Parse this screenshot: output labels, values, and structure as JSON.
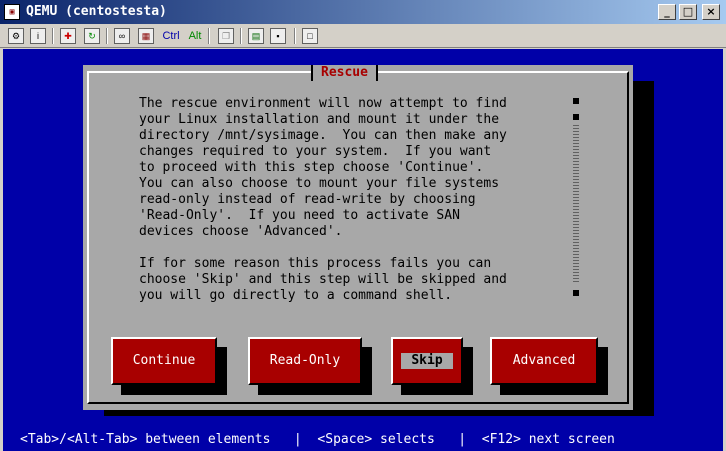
{
  "window": {
    "title": "QEMU (centostesta)",
    "controls": [
      "_",
      "□",
      "×"
    ]
  },
  "toolbar": {
    "ctrl_label": "Ctrl",
    "alt_label": "Alt"
  },
  "dialog": {
    "title": "Rescue",
    "body": "The rescue environment will now attempt to find\nyour Linux installation and mount it under the\ndirectory /mnt/sysimage.  You can then make any\nchanges required to your system.  If you want\nto proceed with this step choose 'Continue'.\nYou can also choose to mount your file systems\nread-only instead of read-write by choosing\n'Read-Only'.  If you need to activate SAN\ndevices choose 'Advanced'.\n\nIf for some reason this process fails you can\nchoose 'Skip' and this step will be skipped and\nyou will go directly to a command shell.",
    "buttons": [
      {
        "label": "Continue"
      },
      {
        "label": "Read-Only"
      },
      {
        "label": "Skip",
        "focused": true
      },
      {
        "label": "Advanced"
      }
    ]
  },
  "statusbar": {
    "text": "<Tab>/<Alt-Tab> between elements   |  <Space> selects   |  <F12> next screen"
  },
  "colors": {
    "screen_bg": "#0000a8",
    "dialog_bg": "#a8a8a8",
    "button_bg": "#a80000",
    "title_color": "#a80000"
  }
}
